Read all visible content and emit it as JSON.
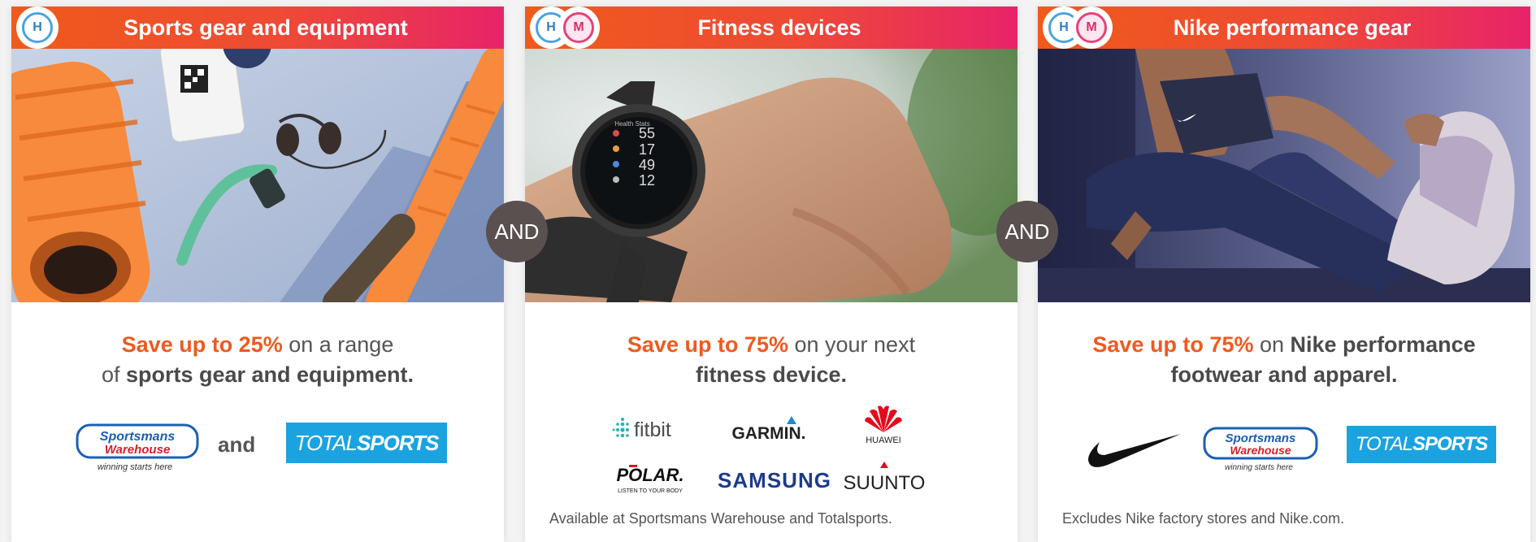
{
  "and_label": "AND",
  "cards": [
    {
      "badges": [
        "H"
      ],
      "title": "Sports gear and equipment",
      "text": {
        "highlight": "Save up to 25%",
        "line1_rest": " on a range",
        "line2_pre": "of ",
        "line2_strong": "sports gear and equipment."
      },
      "connector": "and",
      "logos": {
        "sportsmans_top": "Sportsmans",
        "sportsmans_bottom": "Warehouse",
        "sportsmans_tagline": "winning starts here",
        "totalsports_a": "TOTAL",
        "totalsports_b": "SPORTS"
      }
    },
    {
      "badges": [
        "H",
        "M"
      ],
      "title": "Fitness devices",
      "text": {
        "highlight": "Save up to 75%",
        "line1_rest": " on your next",
        "line2_strong": "fitness device."
      },
      "watch": [
        "55",
        "17",
        "49",
        "12"
      ],
      "watch_header": "Health Stats",
      "logos": {
        "fitbit": "fitbit",
        "garmin": "GARMIN.",
        "huawei": "HUAWEI",
        "polar": "POLAR.",
        "polar_tagline": "LISTEN TO YOUR BODY",
        "samsung": "SAMSUNG",
        "suunto": "SUUNTO"
      },
      "footnote": "Available at Sportsmans Warehouse and Totalsports."
    },
    {
      "badges": [
        "H",
        "M"
      ],
      "title": "Nike performance gear",
      "text": {
        "highlight": "Save up to 75%",
        "line1_rest": " on ",
        "line1_strong": "Nike performance",
        "line2_strong": "footwear and apparel."
      },
      "logos": {
        "sportsmans_top": "Sportsmans",
        "sportsmans_bottom": "Warehouse",
        "sportsmans_tagline": "winning starts here",
        "totalsports_a": "TOTAL",
        "totalsports_b": "SPORTS"
      },
      "footnote": "Excludes Nike factory stores and Nike.com."
    }
  ],
  "colors": {
    "accent_orange": "#ee5a1f",
    "header_start": "#f05a1a",
    "header_end": "#e8236a",
    "and_circle": "#5a5050",
    "totalsports_blue": "#1aa3e0",
    "sportsmans_blue": "#1a5fb4",
    "sportsmans_red": "#d81e28"
  }
}
